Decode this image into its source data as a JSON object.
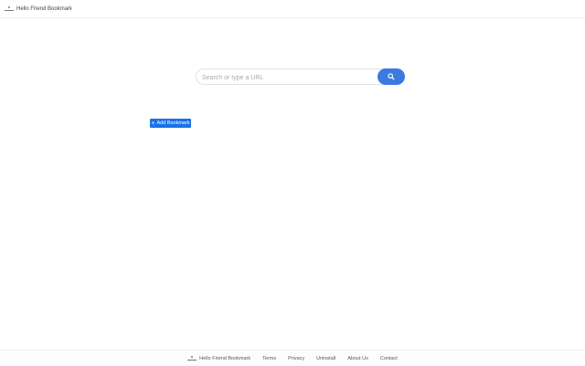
{
  "header": {
    "title": "Hello Friend Bookmark",
    "logo_icon": "logo-icon"
  },
  "search": {
    "placeholder": "Search or type a URL",
    "value": "",
    "button_icon": "search-icon"
  },
  "add_bookmark": {
    "label": "Add Bookmark",
    "icon": "plus-icon"
  },
  "footer": {
    "title": "Hello Friend Bookmark",
    "links": [
      "Terms",
      "Privacy",
      "Uninstall",
      "About Us",
      "Contact"
    ]
  },
  "colors": {
    "accent": "#1a73e8",
    "search_button": "#3b7be0"
  }
}
